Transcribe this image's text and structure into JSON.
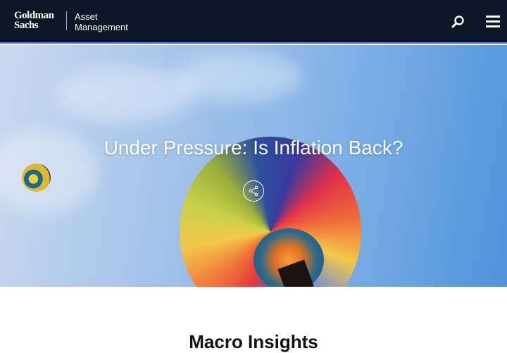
{
  "header": {
    "logo_line1": "Goldman",
    "logo_line2": "Sachs",
    "logo_sub1": "Asset",
    "logo_sub2": "Management",
    "search_icon": "search-icon",
    "menu_icon": "hamburger-menu-icon"
  },
  "hero": {
    "title": "Under Pressure: Is Inflation Back?",
    "share_icon": "share-icon"
  },
  "section": {
    "heading": "Macro Insights"
  },
  "colors": {
    "header_bg": "#0c1726",
    "accent": "#6a6ff0"
  }
}
